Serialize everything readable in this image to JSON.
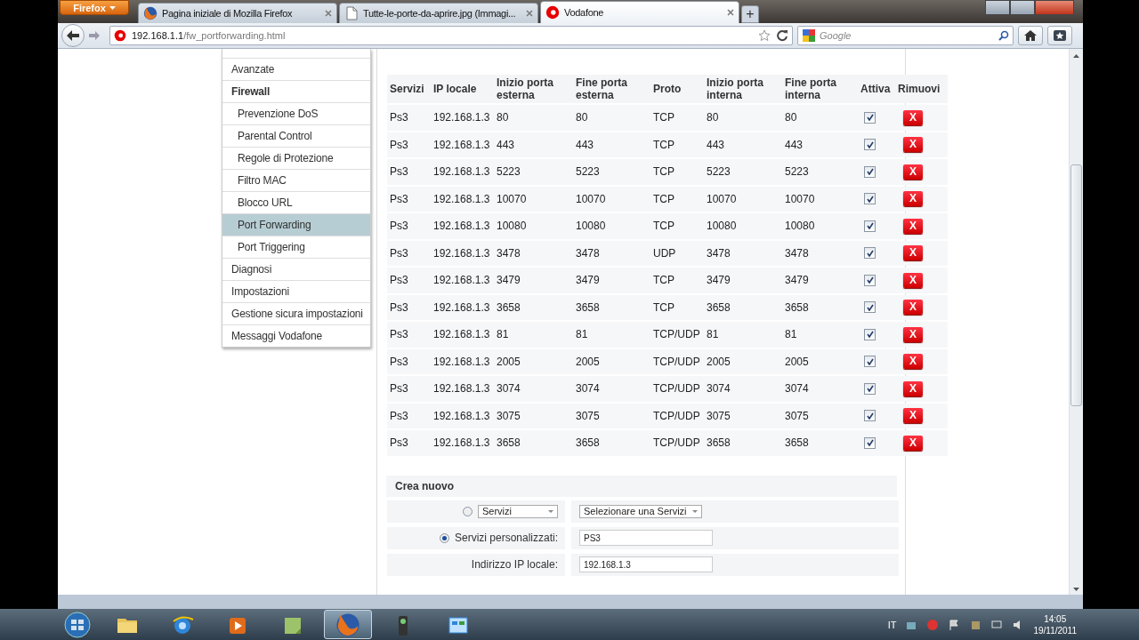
{
  "browser": {
    "menu_button": "Firefox",
    "tabs": [
      {
        "title": "Pagina iniziale di Mozilla Firefox",
        "kind": "firefox",
        "selected": false
      },
      {
        "title": "Tutte-le-porte-da-aprire.jpg (Immagi...",
        "kind": "file",
        "selected": false
      },
      {
        "title": "Vodafone",
        "kind": "vodafone",
        "selected": true
      }
    ],
    "new_tab": "+",
    "url_host": "192.168.1.1",
    "url_path": "/fw_portforwarding.html",
    "search_placeholder": "Google"
  },
  "sidebar": {
    "items": [
      {
        "label": "Avanzate",
        "expanded": false
      },
      {
        "label": "Firewall",
        "expanded": true,
        "children": [
          {
            "label": "Prevenzione DoS",
            "selected": false
          },
          {
            "label": "Parental Control",
            "selected": false
          },
          {
            "label": "Regole di Protezione",
            "selected": false
          },
          {
            "label": "Filtro MAC",
            "selected": false
          },
          {
            "label": "Blocco URL",
            "selected": false
          },
          {
            "label": "Port Forwarding",
            "selected": true
          },
          {
            "label": "Port Triggering",
            "selected": false
          }
        ]
      },
      {
        "label": "Diagnosi",
        "expanded": false
      },
      {
        "label": "Impostazioni",
        "expanded": false
      },
      {
        "label": "Gestione sicura impostazioni",
        "expanded": false
      },
      {
        "label": "Messaggi Vodafone",
        "expanded": false
      }
    ]
  },
  "table": {
    "columns": [
      "Servizi",
      "IP locale",
      "Inizio porta esterna",
      "Fine porta esterna",
      "Proto",
      "Inizio porta interna",
      "Fine porta interna",
      "Attiva",
      "Rimuovi"
    ],
    "rows": [
      {
        "cells": [
          "Ps3",
          "192.168.1.3",
          "80",
          "80",
          "TCP",
          "80",
          "80"
        ],
        "active": true,
        "remove": "X"
      },
      {
        "cells": [
          "Ps3",
          "192.168.1.3",
          "443",
          "443",
          "TCP",
          "443",
          "443"
        ],
        "active": true,
        "remove": "X"
      },
      {
        "cells": [
          "Ps3",
          "192.168.1.3",
          "5223",
          "5223",
          "TCP",
          "5223",
          "5223"
        ],
        "active": true,
        "remove": "X"
      },
      {
        "cells": [
          "Ps3",
          "192.168.1.3",
          "10070",
          "10070",
          "TCP",
          "10070",
          "10070"
        ],
        "active": true,
        "remove": "X"
      },
      {
        "cells": [
          "Ps3",
          "192.168.1.3",
          "10080",
          "10080",
          "TCP",
          "10080",
          "10080"
        ],
        "active": true,
        "remove": "X"
      },
      {
        "cells": [
          "Ps3",
          "192.168.1.3",
          "3478",
          "3478",
          "UDP",
          "3478",
          "3478"
        ],
        "active": true,
        "remove": "X"
      },
      {
        "cells": [
          "Ps3",
          "192.168.1.3",
          "3479",
          "3479",
          "TCP",
          "3479",
          "3479"
        ],
        "active": true,
        "remove": "X"
      },
      {
        "cells": [
          "Ps3",
          "192.168.1.3",
          "3658",
          "3658",
          "TCP",
          "3658",
          "3658"
        ],
        "active": true,
        "remove": "X"
      },
      {
        "cells": [
          "Ps3",
          "192.168.1.3",
          "81",
          "81",
          "TCP/UDP",
          "81",
          "81"
        ],
        "active": true,
        "remove": "X"
      },
      {
        "cells": [
          "Ps3",
          "192.168.1.3",
          "2005",
          "2005",
          "TCP/UDP",
          "2005",
          "2005"
        ],
        "active": true,
        "remove": "X"
      },
      {
        "cells": [
          "Ps3",
          "192.168.1.3",
          "3074",
          "3074",
          "TCP/UDP",
          "3074",
          "3074"
        ],
        "active": true,
        "remove": "X"
      },
      {
        "cells": [
          "Ps3",
          "192.168.1.3",
          "3075",
          "3075",
          "TCP/UDP",
          "3075",
          "3075"
        ],
        "active": true,
        "remove": "X"
      },
      {
        "cells": [
          "Ps3",
          "192.168.1.3",
          "3658",
          "3658",
          "TCP/UDP",
          "3658",
          "3658"
        ],
        "active": true,
        "remove": "X"
      }
    ]
  },
  "create": {
    "title": "Crea nuovo",
    "options": [
      {
        "kind": "select",
        "selected": false,
        "select_value": "Servizi",
        "second_select_value": "Selezionare una Servizi"
      },
      {
        "kind": "custom",
        "selected": true,
        "label": "Servizi personalizzati:",
        "value": "PS3"
      }
    ],
    "ip_label": "Indirizzo IP locale:",
    "ip_value": "192.168.1.3"
  },
  "taskbar": {
    "apps": [
      {
        "kind": "folder",
        "selected": false
      },
      {
        "kind": "ie",
        "selected": false
      },
      {
        "kind": "media",
        "selected": false
      },
      {
        "kind": "note",
        "selected": false
      },
      {
        "kind": "firefox",
        "selected": true
      },
      {
        "kind": "camera",
        "selected": false
      },
      {
        "kind": "panel",
        "selected": false
      }
    ],
    "language": "IT",
    "time": "14:05",
    "date": "19/11/2011"
  }
}
